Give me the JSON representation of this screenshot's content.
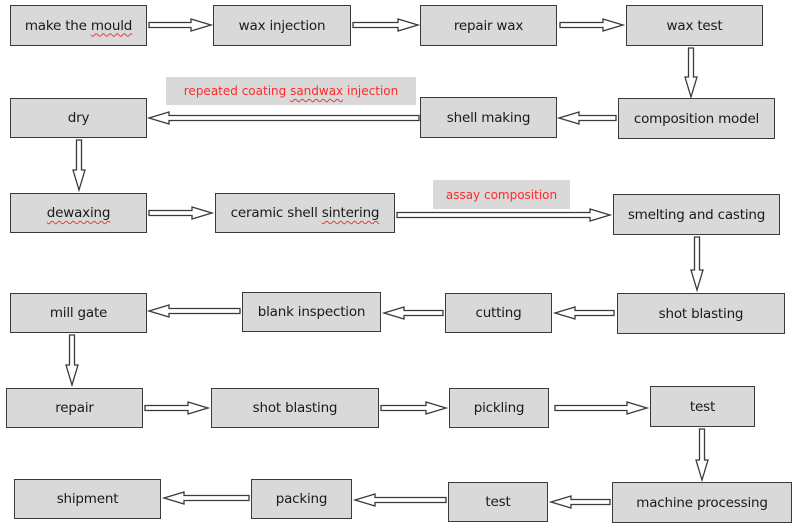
{
  "diagram": {
    "type": "process-flowchart",
    "nodes": [
      {
        "id": "n1",
        "label": "make the mould"
      },
      {
        "id": "n2",
        "label": "wax injection"
      },
      {
        "id": "n3",
        "label": "repair wax"
      },
      {
        "id": "n4",
        "label": "wax test"
      },
      {
        "id": "n5",
        "label": "composition model"
      },
      {
        "id": "n6",
        "label": "shell making"
      },
      {
        "id": "n7",
        "label": "dry"
      },
      {
        "id": "n8",
        "label": "dewaxing"
      },
      {
        "id": "n9",
        "label": "ceramic shell sintering"
      },
      {
        "id": "n10",
        "label": "smelting and casting"
      },
      {
        "id": "n11",
        "label": "shot blasting"
      },
      {
        "id": "n12",
        "label": "cutting"
      },
      {
        "id": "n13",
        "label": "blank inspection"
      },
      {
        "id": "n14",
        "label": "mill gate"
      },
      {
        "id": "n15",
        "label": "repair"
      },
      {
        "id": "n16",
        "label": "shot blasting"
      },
      {
        "id": "n17",
        "label": "pickling"
      },
      {
        "id": "n18",
        "label": "test"
      },
      {
        "id": "n19",
        "label": "machine processing"
      },
      {
        "id": "n20",
        "label": "test"
      },
      {
        "id": "n21",
        "label": "packing"
      },
      {
        "id": "n22",
        "label": "shipment"
      }
    ],
    "edges": [
      {
        "from": "n1",
        "to": "n2"
      },
      {
        "from": "n2",
        "to": "n3"
      },
      {
        "from": "n3",
        "to": "n4"
      },
      {
        "from": "n4",
        "to": "n5"
      },
      {
        "from": "n5",
        "to": "n6"
      },
      {
        "from": "n6",
        "to": "n7",
        "label": "repeated coating sandwax injection"
      },
      {
        "from": "n7",
        "to": "n8"
      },
      {
        "from": "n8",
        "to": "n9"
      },
      {
        "from": "n9",
        "to": "n10",
        "label": "assay composition"
      },
      {
        "from": "n10",
        "to": "n11"
      },
      {
        "from": "n11",
        "to": "n12"
      },
      {
        "from": "n12",
        "to": "n13"
      },
      {
        "from": "n13",
        "to": "n14"
      },
      {
        "from": "n14",
        "to": "n15"
      },
      {
        "from": "n15",
        "to": "n16"
      },
      {
        "from": "n16",
        "to": "n17"
      },
      {
        "from": "n17",
        "to": "n18"
      },
      {
        "from": "n18",
        "to": "n19"
      },
      {
        "from": "n19",
        "to": "n20"
      },
      {
        "from": "n20",
        "to": "n21"
      },
      {
        "from": "n21",
        "to": "n22"
      }
    ],
    "notes": {
      "repeated_coating": "repeated coating sandwax injection",
      "assay": "assay composition"
    },
    "colors": {
      "box_fill": "#d9d9d9",
      "box_border": "#3a3a3a",
      "note_text": "#ff2a2a"
    }
  }
}
